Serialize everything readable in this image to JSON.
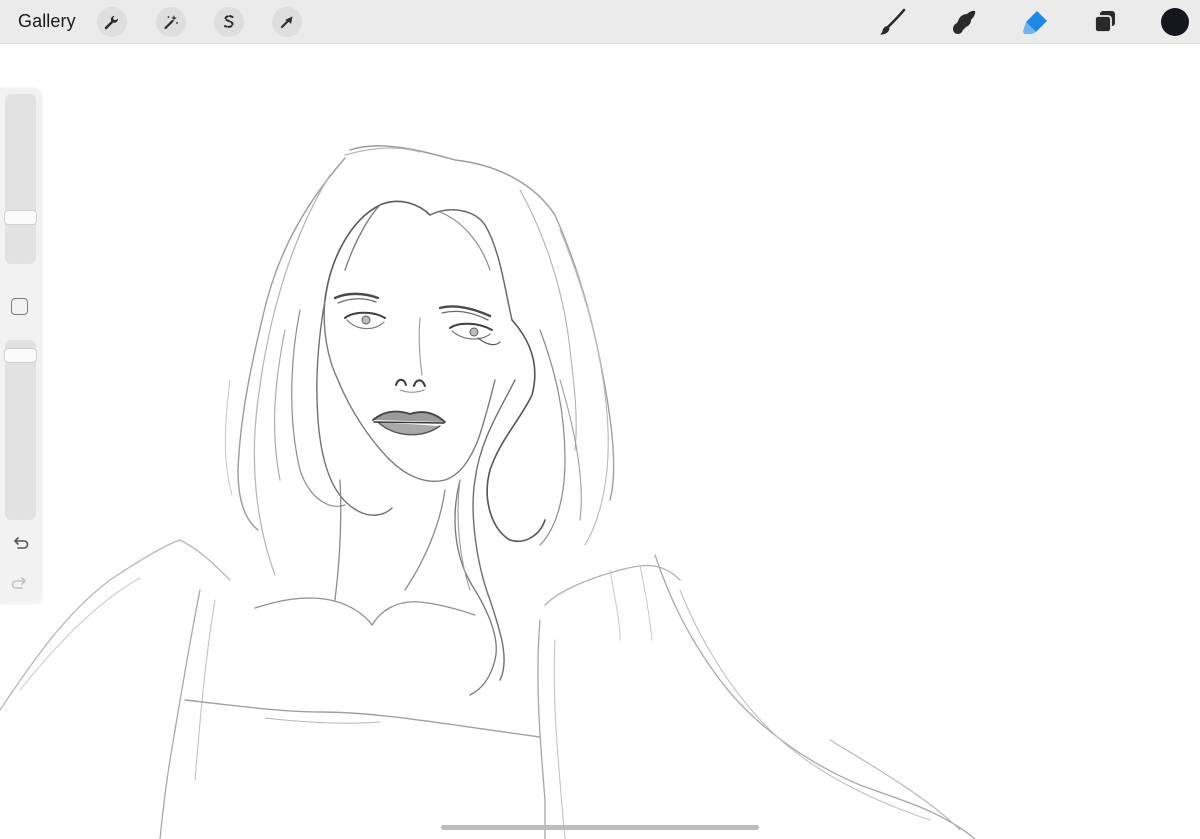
{
  "toolbar": {
    "gallery_label": "Gallery",
    "left_tools": [
      {
        "name": "actions",
        "icon": "wrench-icon"
      },
      {
        "name": "adjustments",
        "icon": "magic-wand-icon"
      },
      {
        "name": "selection",
        "icon": "selection-s-icon"
      },
      {
        "name": "transform",
        "icon": "arrow-cursor-icon"
      }
    ],
    "right_tools": [
      {
        "name": "brush",
        "icon": "brush-icon",
        "active": false
      },
      {
        "name": "smudge",
        "icon": "smudge-finger-icon",
        "active": false
      },
      {
        "name": "eraser",
        "icon": "eraser-icon",
        "active": true
      },
      {
        "name": "layers",
        "icon": "layers-icon",
        "active": false
      }
    ],
    "current_color": "#15171c",
    "active_color": "#1e88e5"
  },
  "sidebar": {
    "brush_size_level": 0.27,
    "opacity_level": 0.95,
    "modify_button": "square-modify-icon",
    "undo_icon": "undo-icon",
    "redo_icon": "redo-icon"
  }
}
